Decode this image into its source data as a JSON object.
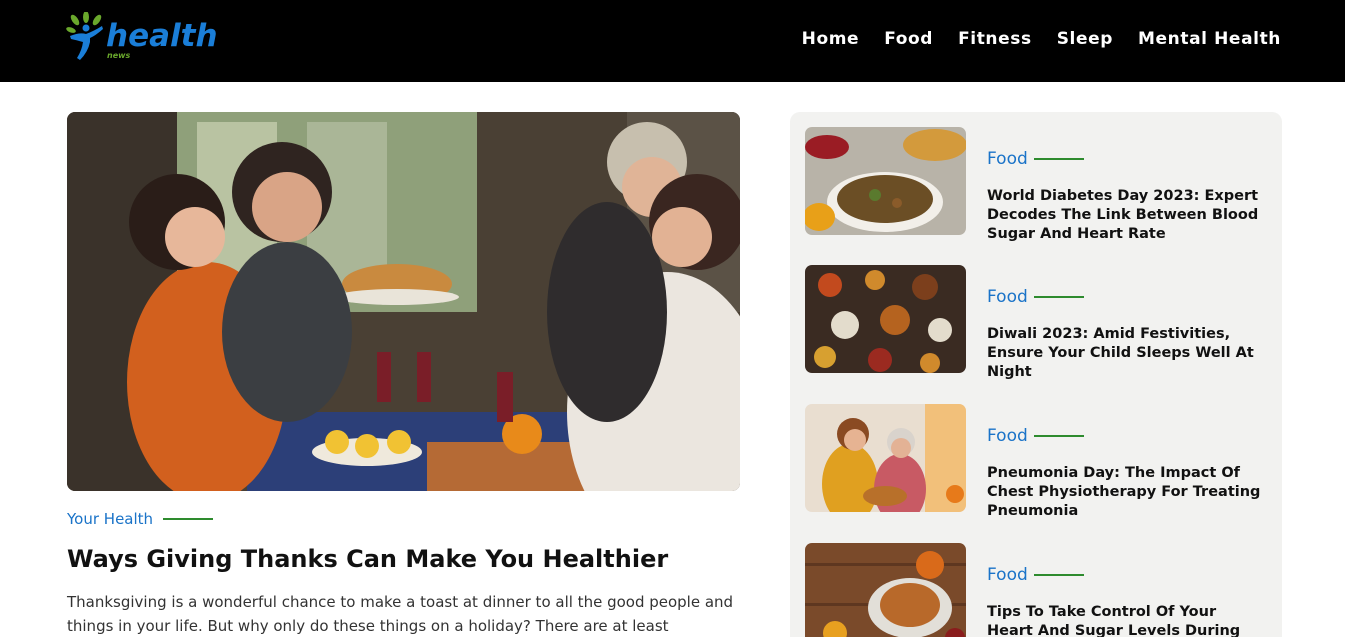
{
  "brand": {
    "name": "health",
    "tagline": "news",
    "colors": {
      "accent": "#1a73c8",
      "line": "#2e8b2e",
      "header_bg": "#000000",
      "sidebar_bg": "#f2f2f0"
    }
  },
  "nav": {
    "items": [
      "Home",
      "Food",
      "Fitness",
      "Sleep",
      "Mental Health"
    ]
  },
  "hero": {
    "category": "Your Health",
    "title": "Ways Giving Thanks Can Make You Healthier",
    "excerpt": "Thanksgiving is a wonderful chance to make a toast at dinner to all the good people and things in your life. But why only do these things on a holiday? There are at least"
  },
  "sidebar": {
    "cards": [
      {
        "category": "Food",
        "title": "World Diabetes Day 2023: Expert Decodes The Link Between Blood Sugar And Heart Rate",
        "thumb": "stuffing-casserole-image"
      },
      {
        "category": "Food",
        "title": "Diwali 2023: Amid Festivities, Ensure Your Child Sleeps Well At Night",
        "thumb": "festive-table-image"
      },
      {
        "category": "Food",
        "title": "Pneumonia Day: The Impact Of Chest Physiotherapy For Treating Pneumonia",
        "thumb": "cooking-together-image"
      },
      {
        "category": "Food",
        "title": "Tips To Take Control Of Your Heart And Sugar Levels During Festive Season",
        "thumb": "roast-turkey-image"
      }
    ]
  }
}
